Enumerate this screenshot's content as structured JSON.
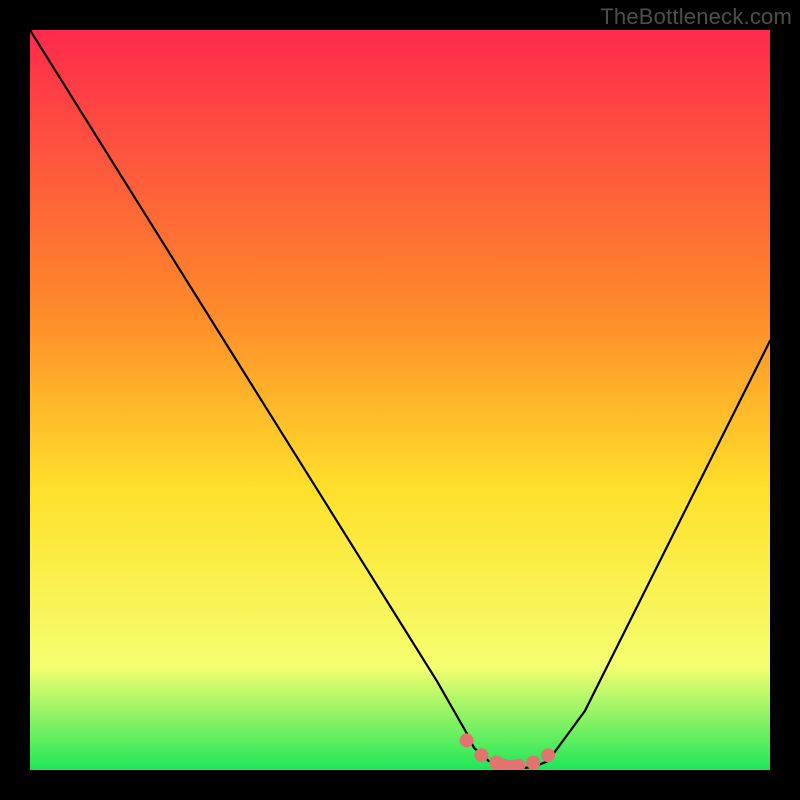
{
  "watermark": "TheBottleneck.com",
  "colors": {
    "bg_black": "#000000",
    "gradient_top": "#ff2a4d",
    "gradient_mid1": "#ff8a2a",
    "gradient_mid2": "#ffe02a",
    "gradient_mid3": "#f5ff70",
    "gradient_bottom": "#1fe65a",
    "curve": "#000000",
    "dot_fill": "#e2736e",
    "dot_stroke": "#cb5a55",
    "watermark": "#4e4e4e"
  },
  "chart_data": {
    "type": "line",
    "title": "",
    "xlabel": "",
    "ylabel": "",
    "ylim": [
      0,
      100
    ],
    "x": [
      0,
      5,
      10,
      15,
      20,
      25,
      30,
      35,
      40,
      45,
      50,
      55,
      59,
      60,
      62,
      64,
      66,
      68,
      70,
      75,
      80,
      85,
      90,
      95,
      100
    ],
    "values": [
      100,
      92,
      84,
      76,
      68,
      60,
      52,
      44,
      36,
      28,
      20,
      12,
      5,
      3,
      1.2,
      0.4,
      0.2,
      0.4,
      1.2,
      8,
      18,
      28,
      38,
      48,
      58
    ],
    "flat_region_x": [
      59,
      61,
      63,
      64,
      65,
      66,
      68,
      70
    ],
    "flat_region_y": [
      4,
      2,
      1,
      0.6,
      0.4,
      0.6,
      1,
      2
    ],
    "annotations": []
  }
}
